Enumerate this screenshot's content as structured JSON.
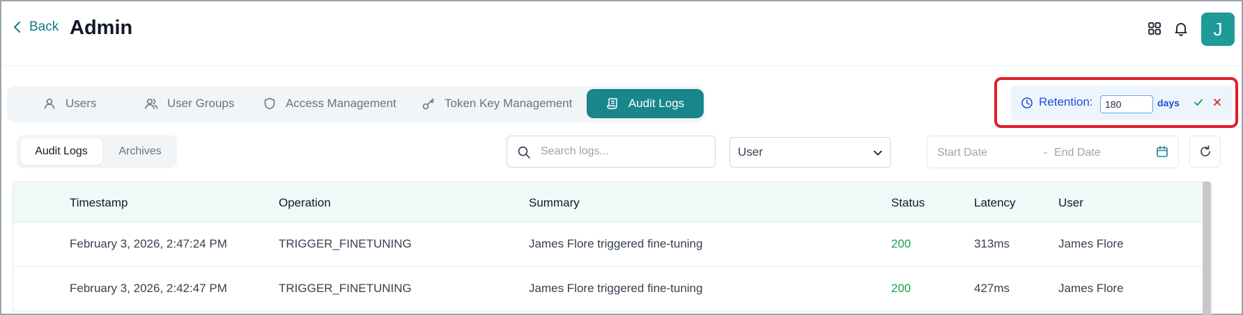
{
  "header": {
    "back_label": "Back",
    "title": "Admin",
    "avatar_initial": "J",
    "icons": [
      "grid-icon",
      "bell-icon"
    ]
  },
  "main_tabs": [
    {
      "label": "Users",
      "icon": "user-icon",
      "active": false
    },
    {
      "label": "User Groups",
      "icon": "users-icon",
      "active": false
    },
    {
      "label": "Access Management",
      "icon": "shield-icon",
      "active": false
    },
    {
      "label": "Token Key Management",
      "icon": "key-icon",
      "active": false
    },
    {
      "label": "Audit Logs",
      "icon": "scroll-icon",
      "active": true
    }
  ],
  "retention": {
    "label": "Retention:",
    "value": "180",
    "unit": "days"
  },
  "sub_tabs": [
    {
      "label": "Audit Logs",
      "active": true
    },
    {
      "label": "Archives",
      "active": false
    }
  ],
  "filters": {
    "search_placeholder": "Search logs...",
    "user_select": "User",
    "start_date_placeholder": "Start Date",
    "separator": "-",
    "end_date_placeholder": "End Date"
  },
  "table": {
    "columns": [
      "Timestamp",
      "Operation",
      "Summary",
      "Status",
      "Latency",
      "User"
    ],
    "rows": [
      {
        "timestamp": "February 3, 2026, 2:47:24 PM",
        "operation": "TRIGGER_FINETUNING",
        "summary": "James Flore triggered fine-tuning",
        "status": "200",
        "latency": "313ms",
        "user": "James Flore"
      },
      {
        "timestamp": "February 3, 2026, 2:42:47 PM",
        "operation": "TRIGGER_FINETUNING",
        "summary": "James Flore triggered fine-tuning",
        "status": "200",
        "latency": "427ms",
        "user": "James Flore"
      }
    ]
  },
  "colors": {
    "accent": "#19858c",
    "status_ok": "#16a34a",
    "highlight": "#e11d2a",
    "retention_text": "#1d4ed8"
  }
}
